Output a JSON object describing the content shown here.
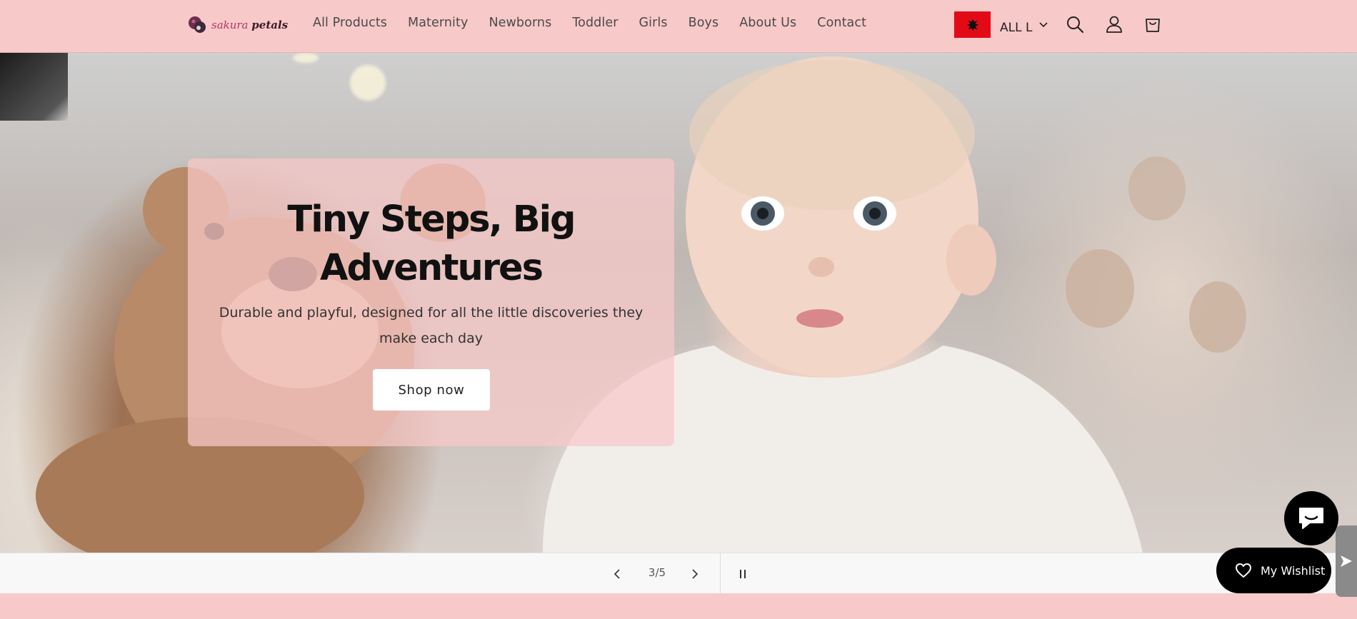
{
  "brand": {
    "name_part1": "sakura",
    "name_part2": "petals"
  },
  "nav": {
    "items": [
      {
        "label": "All Products"
      },
      {
        "label": "Maternity"
      },
      {
        "label": "Newborns"
      },
      {
        "label": "Toddler"
      },
      {
        "label": "Girls"
      },
      {
        "label": "Boys"
      },
      {
        "label": "About Us"
      },
      {
        "label": "Contact"
      }
    ]
  },
  "locale": {
    "currency": "ALL L",
    "flag_icon": "albania-flag-icon"
  },
  "header_icons": [
    "search-icon",
    "account-icon",
    "cart-icon"
  ],
  "hero": {
    "title_line1": "Tiny Steps, Big",
    "title_line2": "Adventures",
    "subtitle_line1": "Durable and playful, designed for all the little discoveries they",
    "subtitle_line2": "make each day",
    "cta_label": "Shop now"
  },
  "slider": {
    "counter": "3/5",
    "current": 3,
    "total": 5
  },
  "floating": {
    "wishlist_label": "My Wishlist"
  },
  "colors": {
    "header_bg": "#f8c9c9",
    "card_bg": "#f8c9c9",
    "dark": "#000000",
    "flag_red": "#e30a17"
  }
}
